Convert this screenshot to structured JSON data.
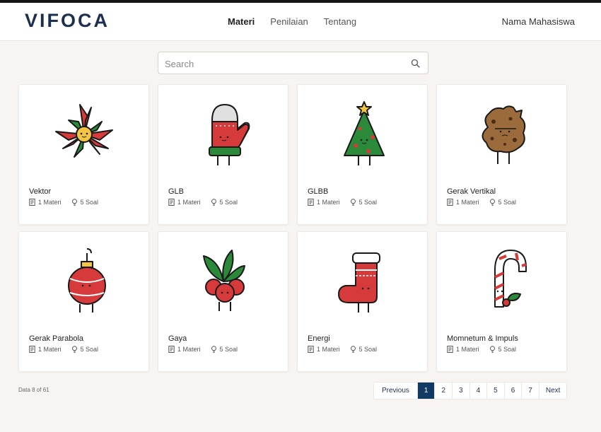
{
  "brand": {
    "logo_text": "VIFOCA"
  },
  "nav": {
    "items": [
      {
        "label": "Materi"
      },
      {
        "label": "Penilaian"
      },
      {
        "label": "Tentang"
      }
    ]
  },
  "user": {
    "name": "Nama Mahasiswa"
  },
  "search": {
    "placeholder": "Search"
  },
  "cards": [
    {
      "title": "Vektor",
      "materi": "1 Materi",
      "soal": "5 Soal",
      "icon": "poinsettia-icon"
    },
    {
      "title": "GLB",
      "materi": "1 Materi",
      "soal": "5 Soal",
      "icon": "mitten-icon"
    },
    {
      "title": "GLBB",
      "materi": "1 Materi",
      "soal": "5 Soal",
      "icon": "christmas-tree-icon"
    },
    {
      "title": "Gerak Vertikal",
      "materi": "1 Materi",
      "soal": "5 Soal",
      "icon": "cookie-icon"
    },
    {
      "title": "Gerak Parabola",
      "materi": "1 Materi",
      "soal": "5 Soal",
      "icon": "ornament-icon"
    },
    {
      "title": "Gaya",
      "materi": "1 Materi",
      "soal": "5 Soal",
      "icon": "holly-berries-icon"
    },
    {
      "title": "Energi",
      "materi": "1 Materi",
      "soal": "5 Soal",
      "icon": "stocking-icon"
    },
    {
      "title": "Momnetum & Impuls",
      "materi": "1 Materi",
      "soal": "5 Soal",
      "icon": "candy-cane-icon"
    }
  ],
  "footer": {
    "data_count": "Data 8 of 61"
  },
  "pagination": {
    "previous": "Previous",
    "pages": [
      "1",
      "2",
      "3",
      "4",
      "5",
      "6",
      "7"
    ],
    "next": "Next",
    "current": "1"
  },
  "colors": {
    "brand": "#1d2f4f",
    "accent": "#113a63",
    "red": "#d63a3a",
    "green": "#2a8a3a"
  }
}
